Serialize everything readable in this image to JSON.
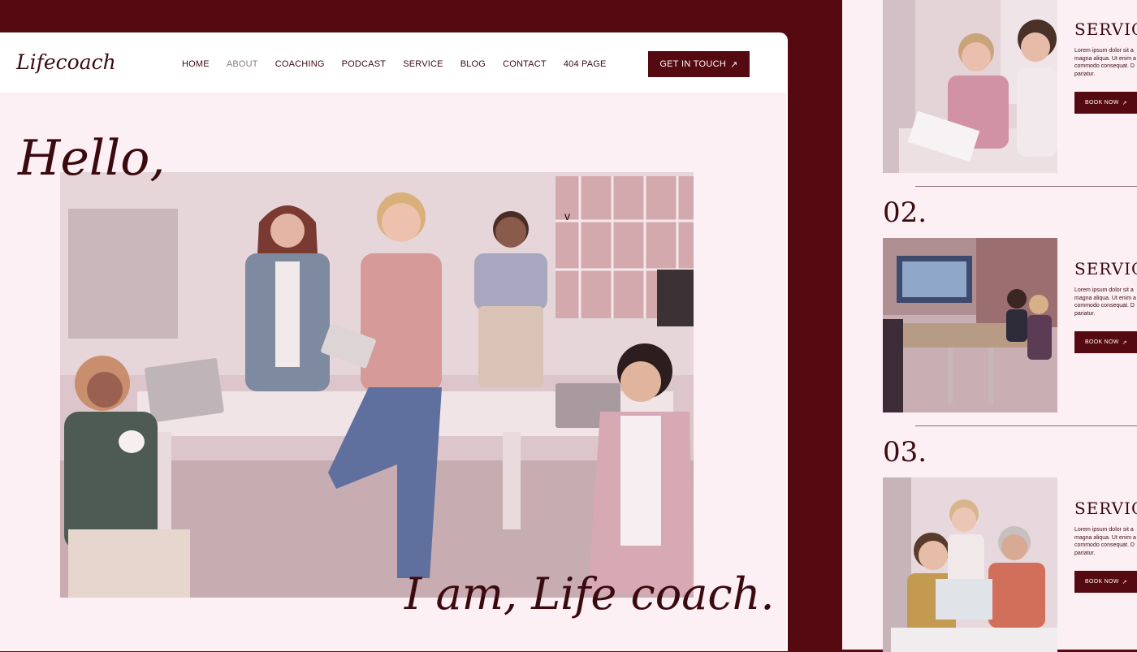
{
  "site": {
    "logo": "Lifecoach",
    "nav": [
      "HOME",
      "ABOUT",
      "COACHING",
      "PODCAST",
      "SERVICE",
      "BLOG",
      "CONTACT",
      "404 PAGE"
    ],
    "active_nav": "ABOUT",
    "cta_label": "GET IN TOUCH",
    "cta_icon": "arrow-up-right-icon"
  },
  "hero": {
    "greeting": "Hello,",
    "tagline": "I am, Life coach.",
    "cursor_glyph": "v"
  },
  "services": [
    {
      "number": "",
      "title": "SERVIC",
      "desc": "Lorem ipsum dolor sit a magna aliqua. Ut enim a commodo consequat. D pariatur.",
      "button": "BOOK NOW"
    },
    {
      "number": "02.",
      "title": "SERVIC",
      "desc": "Lorem ipsum dolor sit a magna aliqua. Ut enim a commodo consequat. D pariatur.",
      "button": "BOOK NOW"
    },
    {
      "number": "03.",
      "title": "SERVIC",
      "desc": "Lorem ipsum dolor sit a magna aliqua. Ut enim a commodo consequat. D pariatur.",
      "button": "BOOK NOW"
    }
  ],
  "colors": {
    "brand": "#540a10",
    "text": "#3b0a10",
    "background": "#fdf0f5",
    "muted_nav": "#8a7a80"
  }
}
